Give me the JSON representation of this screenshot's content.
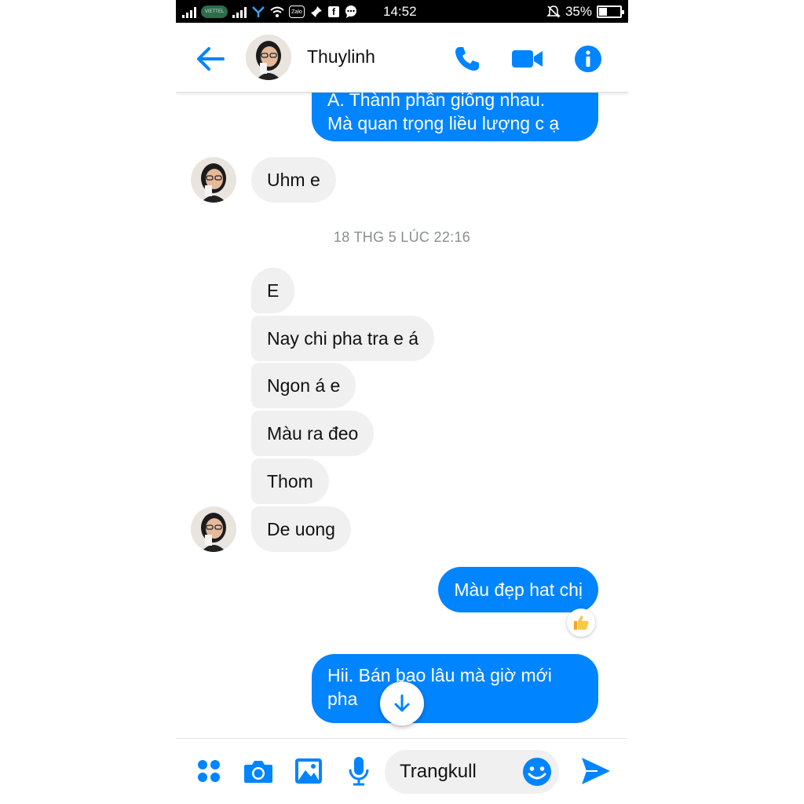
{
  "status_bar": {
    "time": "14:52",
    "battery": "35%",
    "battery_level": 0.35,
    "carrier_label": "VIETTEL",
    "zalo_label": "Zalo",
    "fb_label": "f"
  },
  "header": {
    "contact_name": "Thuylinh"
  },
  "conversation": {
    "top_partial": [
      "A. Thành phần giống nhau.",
      "Mà quan trọng liều lượng c ạ"
    ],
    "reply_1": "Uhm e",
    "timestamp": "18 THG 5 LÚC 22:16",
    "incoming_group": [
      "E",
      "Nay chi pha tra e á",
      "Ngon á e",
      "Màu ra đeo",
      "Thom",
      "De uong"
    ],
    "outgoing_1": "Màu đẹp hat chị",
    "outgoing_1_reaction": "thumbs-up-icon",
    "outgoing_2": [
      "Hii. Bán bao lâu mà giờ mới",
      "pha"
    ]
  },
  "composer": {
    "input_value": "Trangkull"
  },
  "colors": {
    "accent": "#0084ff",
    "incoming_bubble": "#f0f0f0",
    "timestamp_text": "#8a8d91"
  }
}
